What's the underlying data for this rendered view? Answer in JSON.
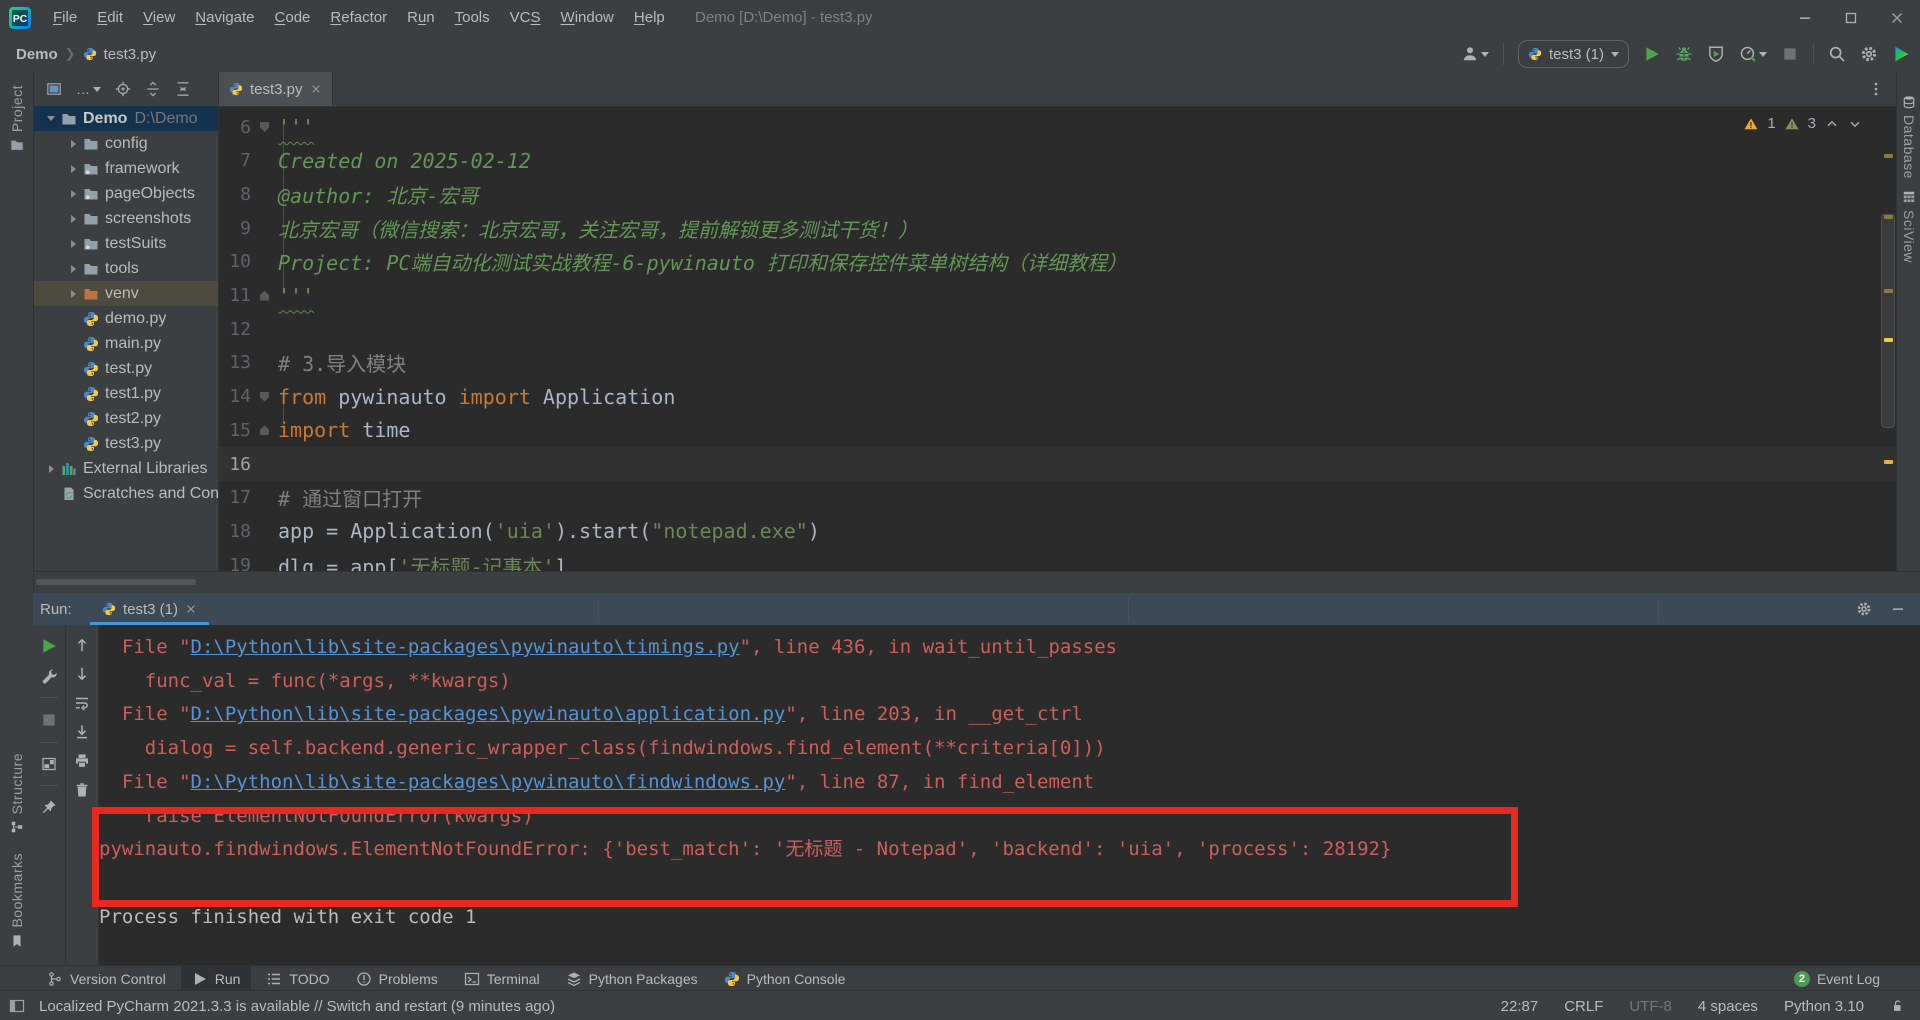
{
  "window": {
    "title": "Demo [D:\\Demo] - test3.py",
    "menus": [
      {
        "pre": "",
        "key": "F",
        "post": "ile"
      },
      {
        "pre": "",
        "key": "E",
        "post": "dit"
      },
      {
        "pre": "",
        "key": "V",
        "post": "iew"
      },
      {
        "pre": "",
        "key": "N",
        "post": "avigate"
      },
      {
        "pre": "",
        "key": "C",
        "post": "ode"
      },
      {
        "pre": "",
        "key": "R",
        "post": "efactor"
      },
      {
        "pre": "R",
        "key": "u",
        "post": "n"
      },
      {
        "pre": "",
        "key": "T",
        "post": "ools"
      },
      {
        "pre": "VC",
        "key": "S",
        "post": ""
      },
      {
        "pre": "",
        "key": "W",
        "post": "indow"
      },
      {
        "pre": "",
        "key": "H",
        "post": "elp"
      }
    ]
  },
  "toolbar": {
    "breadcrumb": [
      "Demo",
      "test3.py"
    ],
    "run_config": "test3 (1)"
  },
  "project": {
    "stripe_top": "Project",
    "stripe_bottom": [
      "Structure",
      "Bookmarks"
    ],
    "tree": [
      {
        "label": "Demo",
        "hint": "D:\\Demo",
        "icon": "folder-icon",
        "level": 0,
        "arrow": "open",
        "sel": "focus",
        "bold": true
      },
      {
        "label": "config",
        "icon": "folder-icon",
        "level": 1,
        "arrow": "closed"
      },
      {
        "label": "framework",
        "icon": "package-folder-icon",
        "level": 1,
        "arrow": "closed"
      },
      {
        "label": "pageObjects",
        "icon": "package-folder-icon",
        "level": 1,
        "arrow": "closed"
      },
      {
        "label": "screenshots",
        "icon": "folder-icon",
        "level": 1,
        "arrow": "closed"
      },
      {
        "label": "testSuits",
        "icon": "package-folder-icon",
        "level": 1,
        "arrow": "closed"
      },
      {
        "label": "tools",
        "icon": "folder-icon",
        "level": 1,
        "arrow": "closed"
      },
      {
        "label": "venv",
        "icon": "excluded-folder-icon",
        "level": 1,
        "arrow": "closed",
        "sel": "soft"
      },
      {
        "label": "demo.py",
        "icon": "python-file-icon",
        "level": 1
      },
      {
        "label": "main.py",
        "icon": "python-file-icon",
        "level": 1
      },
      {
        "label": "test.py",
        "icon": "python-file-icon",
        "level": 1
      },
      {
        "label": "test1.py",
        "icon": "python-file-icon",
        "level": 1
      },
      {
        "label": "test2.py",
        "icon": "python-file-icon",
        "level": 1
      },
      {
        "label": "test3.py",
        "icon": "python-file-icon",
        "level": 1
      },
      {
        "label": "External Libraries",
        "icon": "libraries-icon",
        "level": 0,
        "arrow": "closed"
      },
      {
        "label": "Scratches and Con",
        "icon": "scratches-icon",
        "level": 0
      }
    ]
  },
  "editor": {
    "tab": "test3.py",
    "inspections": {
      "warnings_strong": "1",
      "warnings_weak": "3"
    },
    "right_tabs": [
      "Database",
      "SciView"
    ],
    "lines": [
      {
        "n": "6",
        "fold": "open",
        "seg": [
          {
            "t": "'''",
            "c": "doc",
            "wavy": true
          }
        ]
      },
      {
        "n": "7",
        "seg": [
          {
            "t": "Created on 2025-02-12",
            "c": "doc i"
          }
        ]
      },
      {
        "n": "8",
        "seg": [
          {
            "t": "@author: 北京-宏哥",
            "c": "doc i"
          }
        ]
      },
      {
        "n": "9",
        "seg": [
          {
            "t": "北京宏哥（微信搜索：北京宏哥，关注宏哥，提前解锁更多测试干货！）",
            "c": "doc i"
          }
        ]
      },
      {
        "n": "10",
        "seg": [
          {
            "t": "Project: PC端自动化测试实战教程-6-pywinauto 打印和保存控件菜单树结构（详细教程）",
            "c": "doc i"
          }
        ]
      },
      {
        "n": "11",
        "fold": "close",
        "seg": [
          {
            "t": "'''",
            "c": "doc",
            "wavy": true
          }
        ]
      },
      {
        "n": "12",
        "seg": []
      },
      {
        "n": "13",
        "seg": [
          {
            "t": "# 3.导入模块",
            "c": "cmt"
          }
        ]
      },
      {
        "n": "14",
        "fold": "open",
        "seg": [
          {
            "t": "from",
            "c": "kw"
          },
          {
            "t": " pywinauto ",
            "c": "pln"
          },
          {
            "t": "import",
            "c": "kw"
          },
          {
            "t": " Application",
            "c": "pln"
          }
        ]
      },
      {
        "n": "15",
        "fold": "close",
        "seg": [
          {
            "t": "import",
            "c": "kw"
          },
          {
            "t": " time",
            "c": "pln"
          }
        ]
      },
      {
        "n": "16",
        "cur": true,
        "seg": []
      },
      {
        "n": "17",
        "seg": [
          {
            "t": "# 通过窗口打开",
            "c": "cmt"
          }
        ]
      },
      {
        "n": "18",
        "seg": [
          {
            "t": "app = Application(",
            "c": "pln"
          },
          {
            "t": "'uia'",
            "c": "str"
          },
          {
            "t": ").start(",
            "c": "pln"
          },
          {
            "t": "\"notepad.exe\"",
            "c": "str"
          },
          {
            "t": ")",
            "c": "pln"
          }
        ]
      },
      {
        "n": "19",
        "seg": [
          {
            "t": "dlg = app[",
            "c": "pln"
          },
          {
            "t": "'无标题-记事本'",
            "c": "str"
          },
          {
            "t": "]",
            "c": "pln"
          }
        ]
      }
    ]
  },
  "run_panel": {
    "label": "Run:",
    "tab": "test3 (1)",
    "console": [
      {
        "seg": [
          {
            "t": "  File \"",
            "c": "err"
          },
          {
            "t": "D:\\Python\\lib\\site-packages\\pywinauto\\timings.py",
            "c": "lnk"
          },
          {
            "t": "\", line 436, in wait_until_passes",
            "c": "err"
          }
        ]
      },
      {
        "seg": [
          {
            "t": "    func_val = func(*args, **kwargs)",
            "c": "err"
          }
        ]
      },
      {
        "seg": [
          {
            "t": "  File \"",
            "c": "err"
          },
          {
            "t": "D:\\Python\\lib\\site-packages\\pywinauto\\application.py",
            "c": "lnk"
          },
          {
            "t": "\", line 203, in __get_ctrl",
            "c": "err"
          }
        ]
      },
      {
        "seg": [
          {
            "t": "    dialog = self.backend.generic_wrapper_class(findwindows.find_element(**criteria[0]))",
            "c": "err"
          }
        ]
      },
      {
        "seg": [
          {
            "t": "  File \"",
            "c": "err"
          },
          {
            "t": "D:\\Python\\lib\\site-packages\\pywinauto\\findwindows.py",
            "c": "lnk"
          },
          {
            "t": "\", line 87, in find_element",
            "c": "err"
          }
        ]
      },
      {
        "seg": [
          {
            "t": "    raise ElementNotFoundError(kwargs)",
            "c": "err"
          }
        ]
      },
      {
        "seg": [
          {
            "t": "pywinauto.findwindows.ElementNotFoundError: {'best_match': '无标题 - Notepad', 'backend': 'uia', 'process': 28192}",
            "c": "err"
          }
        ]
      },
      {
        "seg": []
      },
      {
        "seg": [
          {
            "t": "Process finished with exit code 1",
            "c": "out"
          }
        ]
      }
    ]
  },
  "bottom_bar": {
    "tabs": [
      {
        "label": "Version Control",
        "icon": "branch-icon"
      },
      {
        "label": "Run",
        "icon": "run-icon",
        "active": true
      },
      {
        "label": "TODO",
        "icon": "todo-icon"
      },
      {
        "label": "Problems",
        "icon": "problems-icon"
      },
      {
        "label": "Terminal",
        "icon": "terminal-icon"
      },
      {
        "label": "Python Packages",
        "icon": "packages-icon"
      },
      {
        "label": "Python Console",
        "icon": "python-file-icon"
      }
    ],
    "event_log": {
      "badge": "2",
      "label": "Event Log"
    }
  },
  "status_bar": {
    "message": "Localized PyCharm 2021.3.3 is available // Switch and restart (9 minutes ago)",
    "items": [
      {
        "t": "22:87"
      },
      {
        "t": "CRLF"
      },
      {
        "t": "UTF-8",
        "dim": true
      },
      {
        "t": "4 spaces"
      },
      {
        "t": "Python 3.10"
      }
    ]
  },
  "colors": {
    "accent_blue": "#3F9ADA",
    "error_red": "#CE5E59",
    "link_blue": "#5394D8",
    "annotation_red": "#E8291F",
    "run_green": "#4CA54C",
    "warning_yellow": "#F3C83A",
    "selection_blue": "#13324E"
  }
}
